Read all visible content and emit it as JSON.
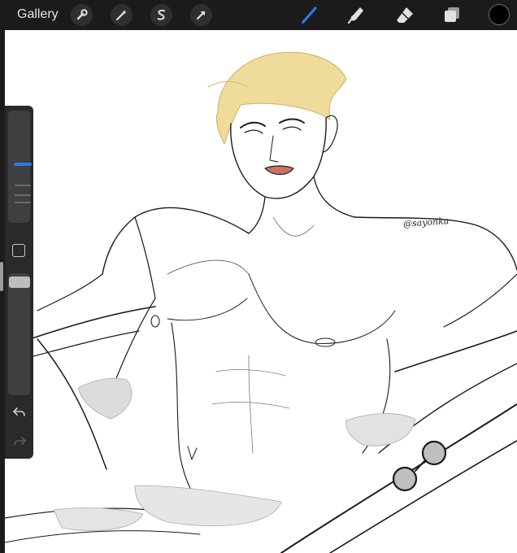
{
  "app": {
    "gallery_label": "Gallery"
  },
  "toolbar": {
    "left_tools": [
      "wrench-icon",
      "magic-wand-icon",
      "selection-s-icon",
      "transform-arrow-icon"
    ],
    "right_tools": [
      "brush-icon",
      "smudge-icon",
      "eraser-icon",
      "layers-icon"
    ],
    "active_tool": "brush-icon",
    "active_color": "#2a7ae8",
    "current_color": "#000000"
  },
  "sidebar": {
    "brush_size_level": 0.52,
    "opacity_level": 0.97
  },
  "canvas": {
    "signature": "@sayonka",
    "hair_color": "#f0dc9a",
    "line_color": "#1a1a1a"
  }
}
